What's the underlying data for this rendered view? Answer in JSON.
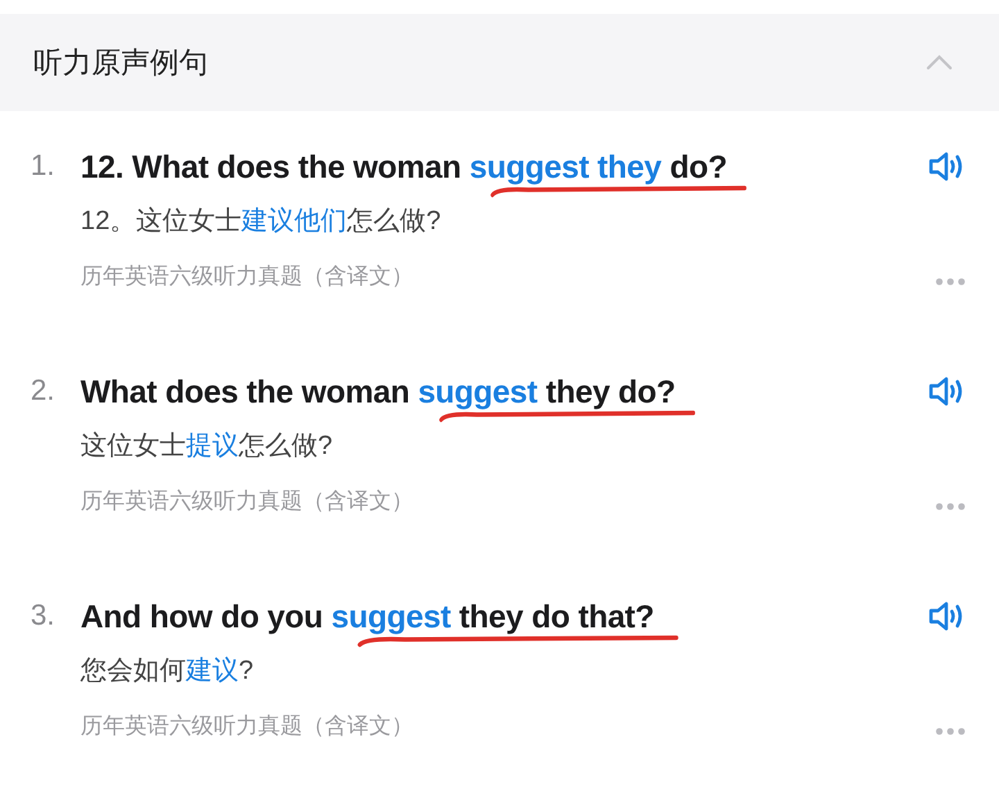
{
  "section": {
    "title": "听力原声例句",
    "expanded": true
  },
  "examples": [
    {
      "number": "1.",
      "sentence": [
        {
          "text": "12. What does the woman ",
          "highlight": false
        },
        {
          "text": "suggest they",
          "highlight": true
        },
        {
          "text": " do?",
          "highlight": false
        }
      ],
      "translation": [
        {
          "text": "12。这位女士",
          "highlight": false
        },
        {
          "text": "建议他们",
          "highlight": true
        },
        {
          "text": "怎么做?",
          "highlight": false
        }
      ],
      "source": "历年英语六级听力真题（含译文）",
      "underlined": true
    },
    {
      "number": "2.",
      "sentence": [
        {
          "text": "What does the woman ",
          "highlight": false
        },
        {
          "text": "suggest",
          "highlight": true
        },
        {
          "text": " they do?",
          "highlight": false
        }
      ],
      "translation": [
        {
          "text": "这位女士",
          "highlight": false
        },
        {
          "text": "提议",
          "highlight": true
        },
        {
          "text": "怎么做?",
          "highlight": false
        }
      ],
      "source": "历年英语六级听力真题（含译文）",
      "underlined": true
    },
    {
      "number": "3.",
      "sentence": [
        {
          "text": "And how do you ",
          "highlight": false
        },
        {
          "text": "suggest",
          "highlight": true
        },
        {
          "text": " they do that?",
          "highlight": false
        }
      ],
      "translation": [
        {
          "text": "您会如何",
          "highlight": false
        },
        {
          "text": "建议",
          "highlight": true
        },
        {
          "text": "?",
          "highlight": false
        }
      ],
      "source": "历年英语六级听力真题（含译文）",
      "underlined": true
    }
  ]
}
